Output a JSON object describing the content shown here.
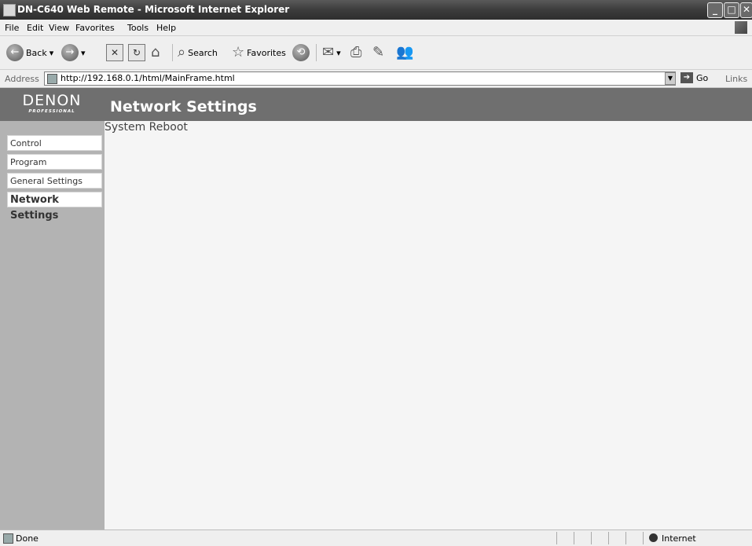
{
  "window": {
    "title": "DN-C640 Web Remote - Microsoft Internet Explorer"
  },
  "menu": [
    "File",
    "Edit",
    "View",
    "Favorites",
    "Tools",
    "Help"
  ],
  "toolbar": {
    "back_label": "Back",
    "search_label": "Search",
    "favorites_label": "Favorites"
  },
  "address": {
    "label": "Address",
    "url": "http://192.168.0.1/html/MainFrame.html",
    "go_label": "Go",
    "links_label": "Links"
  },
  "page": {
    "logo_brand": "DENON",
    "logo_sub": "PROFESSIONAL",
    "title": "Network Settings",
    "nav": [
      "Control",
      "Program",
      "General Settings",
      "Network Settings"
    ],
    "active_nav": "Network Settings",
    "content_link": "System Reboot"
  },
  "status": {
    "text": "Done",
    "zone": "Internet"
  }
}
